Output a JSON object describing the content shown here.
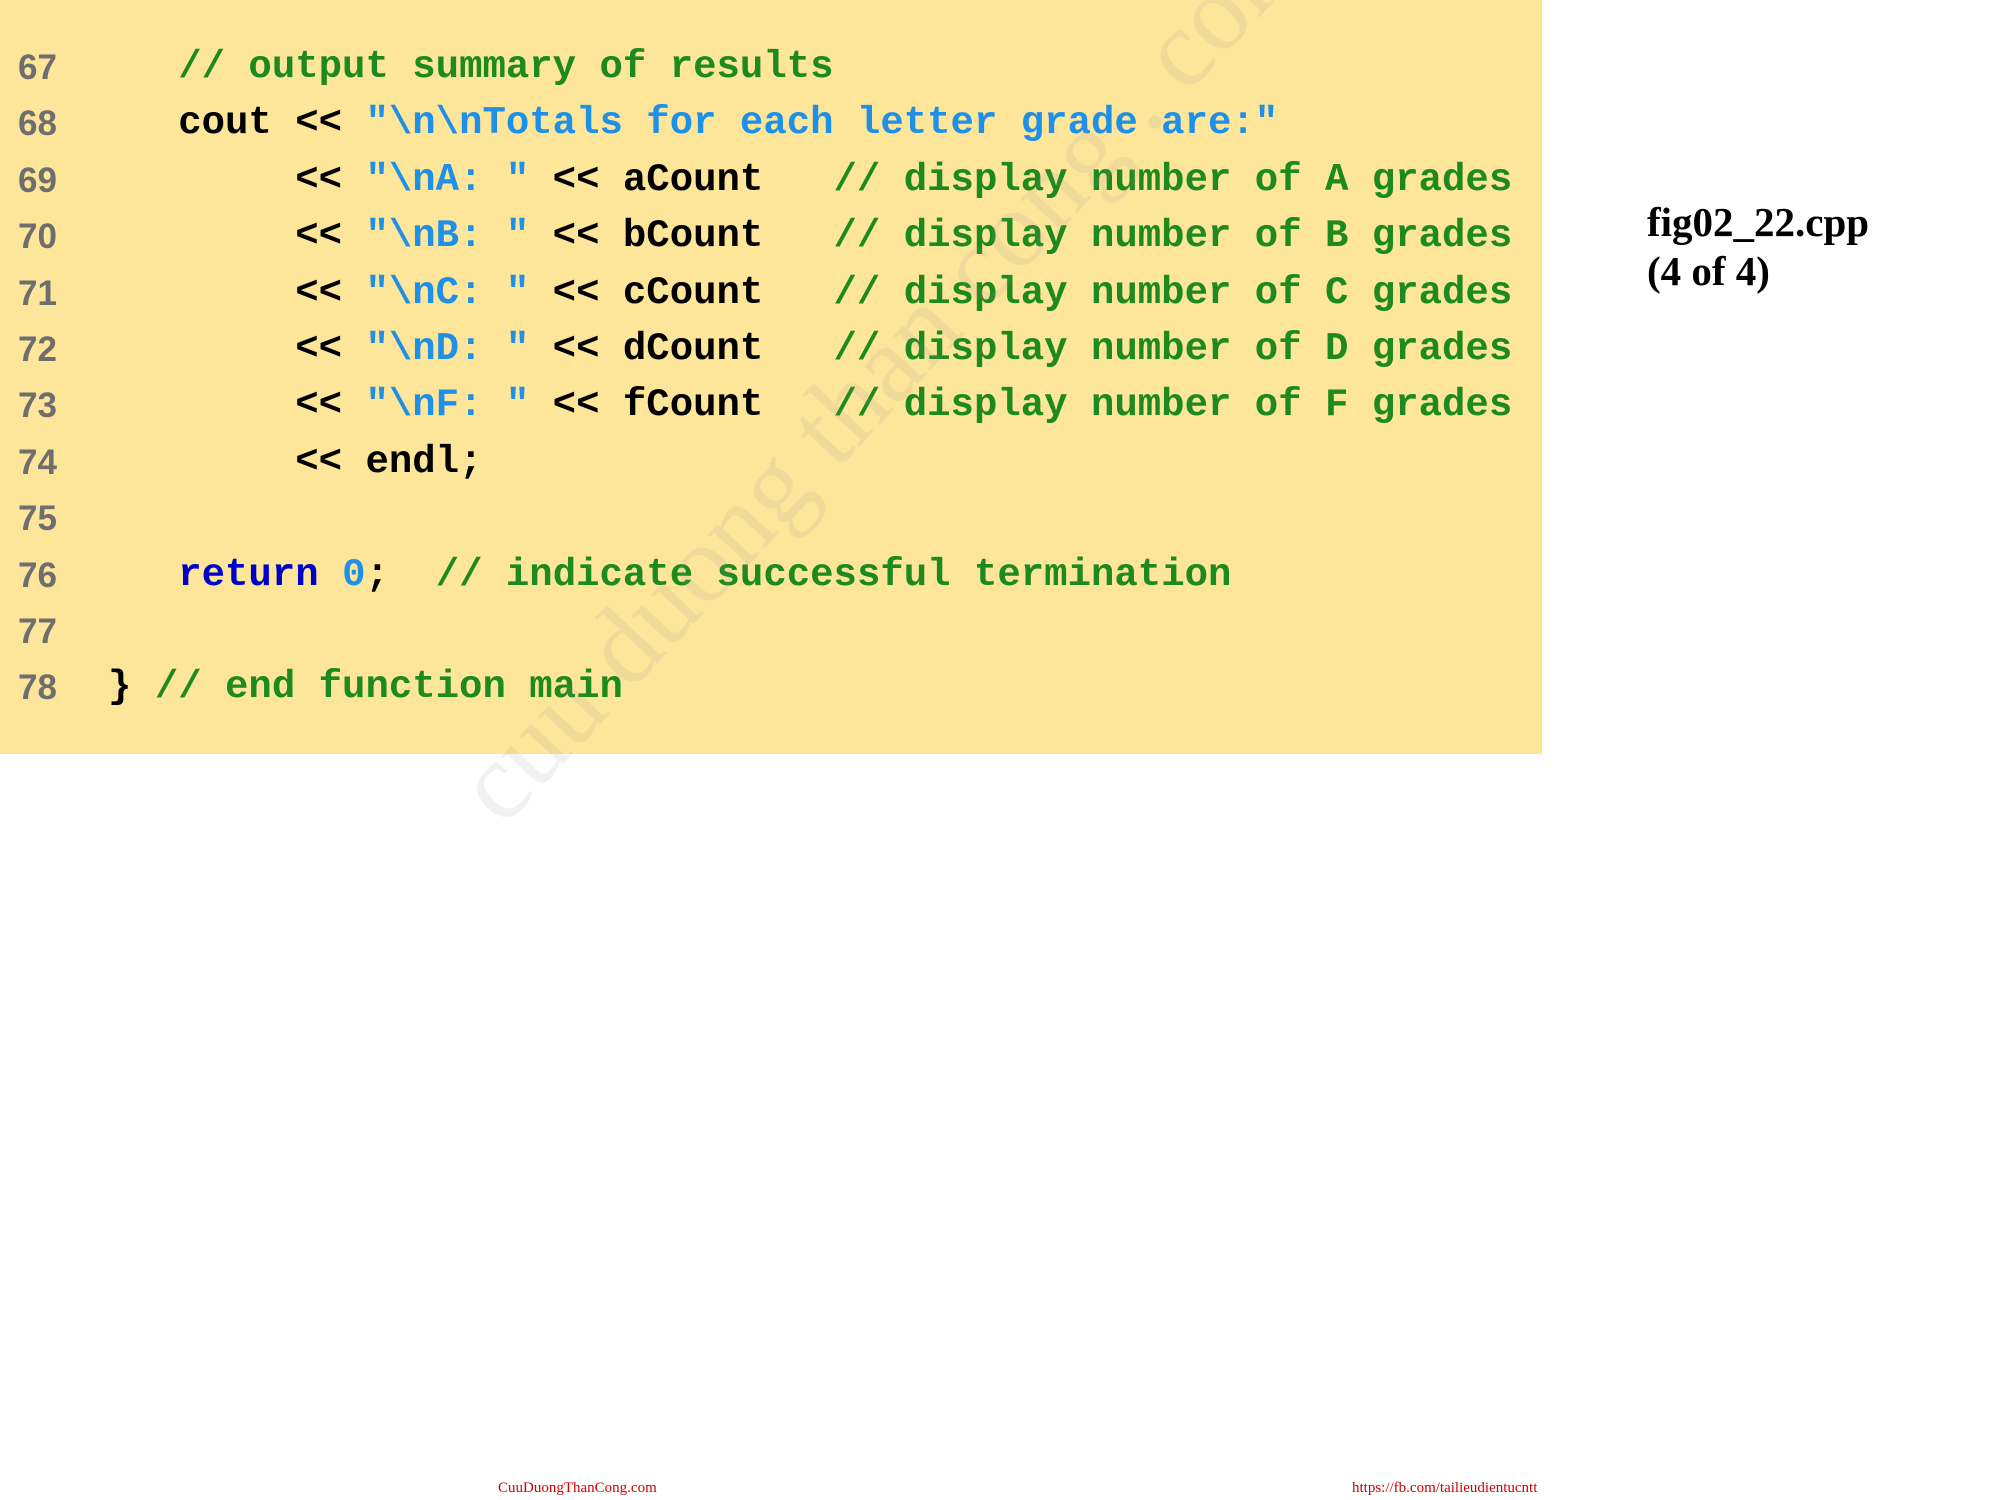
{
  "code": {
    "lines": [
      {
        "num": "67",
        "indent": "   ",
        "tokens": [
          {
            "t": "cmt",
            "v": "// output summary of results"
          }
        ]
      },
      {
        "num": "68",
        "indent": "   ",
        "tokens": [
          {
            "t": "text",
            "v": "cout << "
          },
          {
            "t": "str",
            "v": "\"\\n\\nTotals for each letter grade are:\""
          }
        ]
      },
      {
        "num": "69",
        "indent": "        ",
        "tokens": [
          {
            "t": "text",
            "v": "<< "
          },
          {
            "t": "str",
            "v": "\"\\nA: \""
          },
          {
            "t": "text",
            "v": " << aCount   "
          },
          {
            "t": "cmt",
            "v": "// display number of A grades"
          }
        ]
      },
      {
        "num": "70",
        "indent": "        ",
        "tokens": [
          {
            "t": "text",
            "v": "<< "
          },
          {
            "t": "str",
            "v": "\"\\nB: \""
          },
          {
            "t": "text",
            "v": " << bCount   "
          },
          {
            "t": "cmt",
            "v": "// display number of B grades"
          }
        ]
      },
      {
        "num": "71",
        "indent": "        ",
        "tokens": [
          {
            "t": "text",
            "v": "<< "
          },
          {
            "t": "str",
            "v": "\"\\nC: \""
          },
          {
            "t": "text",
            "v": " << cCount   "
          },
          {
            "t": "cmt",
            "v": "// display number of C grades"
          }
        ]
      },
      {
        "num": "72",
        "indent": "        ",
        "tokens": [
          {
            "t": "text",
            "v": "<< "
          },
          {
            "t": "str",
            "v": "\"\\nD: \""
          },
          {
            "t": "text",
            "v": " << dCount   "
          },
          {
            "t": "cmt",
            "v": "// display number of D grades"
          }
        ]
      },
      {
        "num": "73",
        "indent": "        ",
        "tokens": [
          {
            "t": "text",
            "v": "<< "
          },
          {
            "t": "str",
            "v": "\"\\nF: \""
          },
          {
            "t": "text",
            "v": " << fCount   "
          },
          {
            "t": "cmt",
            "v": "// display number of F grades"
          }
        ]
      },
      {
        "num": "74",
        "indent": "        ",
        "tokens": [
          {
            "t": "text",
            "v": "<< endl;"
          }
        ]
      },
      {
        "num": "75",
        "indent": "",
        "tokens": []
      },
      {
        "num": "76",
        "indent": "   ",
        "tokens": [
          {
            "t": "kw",
            "v": "return"
          },
          {
            "t": "text",
            "v": " "
          },
          {
            "t": "num",
            "v": "0"
          },
          {
            "t": "text",
            "v": ";  "
          },
          {
            "t": "cmt",
            "v": "// indicate successful termination"
          }
        ]
      },
      {
        "num": "77",
        "indent": "",
        "tokens": []
      },
      {
        "num": "78",
        "indent": "",
        "tokens": [
          {
            "t": "text",
            "v": "} "
          },
          {
            "t": "cmt",
            "v": "// end function main"
          }
        ]
      }
    ]
  },
  "figure": {
    "filename": "fig02_22.cpp",
    "page": "(4 of 4)"
  },
  "watermark": "cuu duong than cong . com",
  "footer": {
    "left": "CuuDuongThanCong.com",
    "right": "https://fb.com/tailieudientucntt"
  },
  "colors": {
    "panel_bg": "#fde59a",
    "string": "#1e90e8",
    "comment": "#1c8a1c",
    "keyword": "#0000c8",
    "line_number": "#6e6e6e",
    "footer_text": "#d00000"
  }
}
